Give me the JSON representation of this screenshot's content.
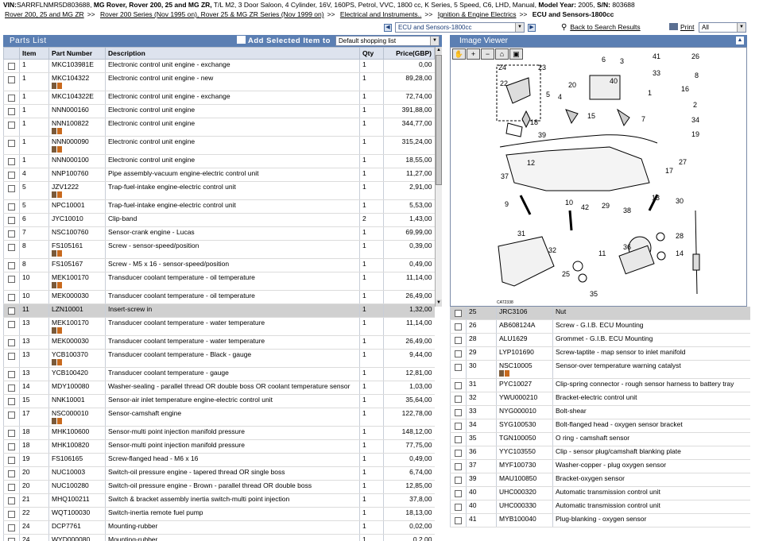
{
  "vehicle": {
    "vin_label": "VIN:",
    "vin": "SARRFLNMR5D803688,",
    "make_model": "MG Rover,  Rover 200, 25 and MG ZR,",
    "trim": "T/L M2, 3 Door Saloon, 4 Cylinder, 16V, 160PS, Petrol, VVC, 1800 cc, K Series, 5 Speed, C6, LHD, Manual,",
    "year_label": "Model Year:",
    "year": "2005,",
    "sn_label": "S/N:",
    "sn": "803688"
  },
  "breadcrumb": [
    "Rover 200, 25 and MG ZR",
    "Rover 200 Series (Nov 1995 on), Rover 25 & MG ZR Series (Nov 1999 on)",
    "Electrical and Instruments..",
    "Ignition & Engine Electrics"
  ],
  "breadcrumb_current": "ECU and Sensors-1800cc",
  "toolbar": {
    "group_select": "ECU and Sensors-1800cc",
    "back_link": "Back to Search Results",
    "print_link": "Print",
    "print_select": "All"
  },
  "parts_list": {
    "title": "Parts List",
    "add_label": "Add Selected Item to",
    "shopping_list": "Default shopping list",
    "columns": [
      "Item",
      "Part Number",
      "Description",
      "Qty",
      "Price(GBP)"
    ],
    "rows": [
      {
        "item": "1",
        "part": "MKC103981E",
        "desc": "Electronic control unit engine - exchange",
        "qty": "1",
        "price": "0,00",
        "icons": false
      },
      {
        "item": "1",
        "part": "MKC104322",
        "desc": "Electronic control unit engine - new",
        "qty": "1",
        "price": "89,28,00",
        "icons": true
      },
      {
        "item": "1",
        "part": "MKC104322E",
        "desc": "Electronic control unit engine - exchange",
        "qty": "1",
        "price": "72,74,00",
        "icons": false
      },
      {
        "item": "1",
        "part": "NNN000160",
        "desc": "Electronic control unit engine",
        "qty": "1",
        "price": "391,88,00",
        "icons": false
      },
      {
        "item": "1",
        "part": "NNN100822",
        "desc": "Electronic control unit engine",
        "qty": "1",
        "price": "344,77,00",
        "icons": true
      },
      {
        "item": "1",
        "part": "NNN000090",
        "desc": "Electronic control unit engine",
        "qty": "1",
        "price": "315,24,00",
        "icons": true
      },
      {
        "item": "1",
        "part": "NNN000100",
        "desc": "Electronic control unit engine",
        "qty": "1",
        "price": "18,55,00",
        "icons": false
      },
      {
        "item": "4",
        "part": "NNP100760",
        "desc": "Pipe assembly-vacuum engine-electric control unit",
        "qty": "1",
        "price": "11,27,00",
        "icons": false
      },
      {
        "item": "5",
        "part": "JZV1222",
        "desc": "Trap-fuel-intake engine-electric control unit",
        "qty": "1",
        "price": "2,91,00",
        "icons": true
      },
      {
        "item": "5",
        "part": "NPC10001",
        "desc": "Trap-fuel-intake engine-electric control unit",
        "qty": "1",
        "price": "5,53,00",
        "icons": false
      },
      {
        "item": "6",
        "part": "JYC10010",
        "desc": "Clip-band",
        "qty": "2",
        "price": "1,43,00",
        "icons": false
      },
      {
        "item": "7",
        "part": "NSC100760",
        "desc": "Sensor-crank engine - Lucas",
        "qty": "1",
        "price": "69,99,00",
        "icons": false
      },
      {
        "item": "8",
        "part": "FS105161",
        "desc": "Screw - sensor-speed/position",
        "qty": "1",
        "price": "0,39,00",
        "icons": true
      },
      {
        "item": "8",
        "part": "FS105167",
        "desc": "Screw - M5 x 16 - sensor-speed/position",
        "qty": "1",
        "price": "0,49,00",
        "icons": false
      },
      {
        "item": "10",
        "part": "MEK100170",
        "desc": "Transducer coolant temperature - oil temperature",
        "qty": "1",
        "price": "11,14,00",
        "icons": true
      },
      {
        "item": "10",
        "part": "MEK000030",
        "desc": "Transducer coolant temperature - oil temperature",
        "qty": "1",
        "price": "26,49,00",
        "icons": false
      },
      {
        "item": "11",
        "part": "LZN10001",
        "desc": "Insert-screw in",
        "qty": "1",
        "price": "1,32,00",
        "icons": false,
        "selected": true
      },
      {
        "item": "13",
        "part": "MEK100170",
        "desc": "Transducer coolant temperature - water temperature",
        "qty": "1",
        "price": "11,14,00",
        "icons": true
      },
      {
        "item": "13",
        "part": "MEK000030",
        "desc": "Transducer coolant temperature - water temperature",
        "qty": "1",
        "price": "26,49,00",
        "icons": false
      },
      {
        "item": "13",
        "part": "YCB100370",
        "desc": "Transducer coolant temperature - Black - gauge",
        "qty": "1",
        "price": "9,44,00",
        "icons": true
      },
      {
        "item": "13",
        "part": "YCB100420",
        "desc": "Transducer coolant temperature - gauge",
        "qty": "1",
        "price": "12,81,00",
        "icons": false
      },
      {
        "item": "14",
        "part": "MDY100080",
        "desc": "Washer-sealing - parallel thread OR double boss OR coolant temperature sensor",
        "qty": "1",
        "price": "1,03,00",
        "icons": false
      },
      {
        "item": "15",
        "part": "NNK10001",
        "desc": "Sensor-air inlet temperature engine-electric control unit",
        "qty": "1",
        "price": "35,64,00",
        "icons": false
      },
      {
        "item": "17",
        "part": "NSC000010",
        "desc": "Sensor-camshaft engine",
        "qty": "1",
        "price": "122,78,00",
        "icons": true
      },
      {
        "item": "18",
        "part": "MHK100600",
        "desc": "Sensor-multi point injection manifold pressure",
        "qty": "1",
        "price": "148,12,00",
        "icons": false
      },
      {
        "item": "18",
        "part": "MHK100820",
        "desc": "Sensor-multi point injection manifold pressure",
        "qty": "1",
        "price": "77,75,00",
        "icons": false
      },
      {
        "item": "19",
        "part": "FS106165",
        "desc": "Screw-flanged head - M6 x 16",
        "qty": "1",
        "price": "0,49,00",
        "icons": false
      },
      {
        "item": "20",
        "part": "NUC10003",
        "desc": "Switch-oil pressure engine - tapered thread OR single boss",
        "qty": "1",
        "price": "6,74,00",
        "icons": false
      },
      {
        "item": "20",
        "part": "NUC100280",
        "desc": "Switch-oil pressure engine - Brown - parallel thread OR double boss",
        "qty": "1",
        "price": "12,85,00",
        "icons": false
      },
      {
        "item": "21",
        "part": "MHQ100211",
        "desc": "Switch & bracket assembly inertia switch-multi point injection",
        "qty": "1",
        "price": "37,8,00",
        "icons": false
      },
      {
        "item": "22",
        "part": "WQT100030",
        "desc": "Switch-inertia remote fuel pump",
        "qty": "1",
        "price": "18,13,00",
        "icons": false
      },
      {
        "item": "24",
        "part": "DCP7761",
        "desc": "Mounting-rubber",
        "qty": "1",
        "price": "0,02,00",
        "icons": false
      },
      {
        "item": "24",
        "part": "WYD000080",
        "desc": "Mounting-rubber",
        "qty": "1",
        "price": "0,2,00",
        "icons": false
      }
    ]
  },
  "image_viewer": {
    "title": "Image Viewer",
    "tools": [
      "hand-icon",
      "zoom-in-icon",
      "zoom-out-icon",
      "home-icon",
      "fit-icon"
    ],
    "catalog_ref": "CAT2338",
    "callouts": [
      "24",
      "23",
      "6",
      "41",
      "26",
      "3",
      "33",
      "8",
      "20",
      "40",
      "22",
      "4",
      "5",
      "1",
      "16",
      "2",
      "18",
      "39",
      "15",
      "7",
      "34",
      "19",
      "12",
      "37",
      "17",
      "27",
      "13",
      "9",
      "10",
      "42",
      "29",
      "38",
      "30",
      "31",
      "32",
      "28",
      "11",
      "36",
      "14",
      "25",
      "35"
    ]
  },
  "right_list": {
    "rows": [
      {
        "item": "25",
        "part": "JRC3106",
        "desc": "Nut",
        "icons": false,
        "selected": true
      },
      {
        "item": "26",
        "part": "AB608124A",
        "desc": "Screw - G.I.B. ECU Mounting",
        "icons": false
      },
      {
        "item": "28",
        "part": "ALU1629",
        "desc": "Grommet - G.I.B. ECU Mounting",
        "icons": false
      },
      {
        "item": "29",
        "part": "LYP101690",
        "desc": "Screw-taptite - map sensor to inlet manifold",
        "icons": false
      },
      {
        "item": "30",
        "part": "NSC10005",
        "desc": "Sensor-over temperature warning catalyst",
        "icons": true
      },
      {
        "item": "31",
        "part": "PYC10027",
        "desc": "Clip-spring connector - rough sensor harness to battery tray",
        "icons": false
      },
      {
        "item": "32",
        "part": "YWU000210",
        "desc": "Bracket-electric control unit",
        "icons": false
      },
      {
        "item": "33",
        "part": "NYG000010",
        "desc": "Bolt-shear",
        "icons": false
      },
      {
        "item": "34",
        "part": "SYG100530",
        "desc": "Bolt-flanged head - oxygen sensor bracket",
        "icons": false
      },
      {
        "item": "35",
        "part": "TGN100050",
        "desc": "O ring - camshaft sensor",
        "icons": false
      },
      {
        "item": "36",
        "part": "YYC103550",
        "desc": "Clip - sensor plug/camshaft blanking plate",
        "icons": false
      },
      {
        "item": "37",
        "part": "MYF100730",
        "desc": "Washer-copper - plug oxygen sensor",
        "icons": false
      },
      {
        "item": "39",
        "part": "MAU100850",
        "desc": "Bracket-oxygen sensor",
        "icons": false
      },
      {
        "item": "40",
        "part": "UHC000320",
        "desc": "Automatic transmission control unit",
        "icons": false
      },
      {
        "item": "40",
        "part": "UHC000330",
        "desc": "Automatic transmission control unit",
        "icons": false
      },
      {
        "item": "41",
        "part": "MYB100040",
        "desc": "Plug-blanking - oxygen sensor",
        "icons": false
      }
    ]
  }
}
